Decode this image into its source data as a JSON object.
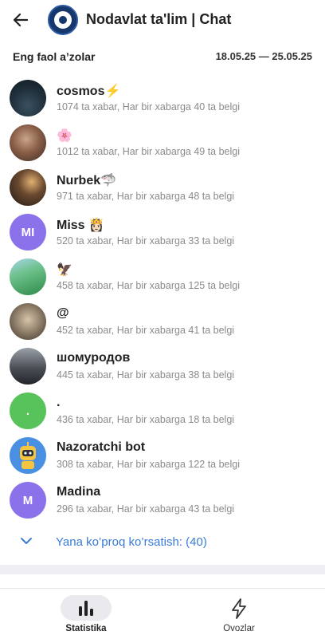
{
  "header": {
    "title": "Nodavlat ta'lim | Chat"
  },
  "section": {
    "title": "Eng faol a’zolar",
    "date_range": "18.05.25 — 25.05.25"
  },
  "members": [
    {
      "name": "cosmos⚡",
      "stats": "1074 ta xabar, Har bir xabarga 40 ta belgi",
      "avatar_initials": "",
      "avatar_color": "#1f2f3a"
    },
    {
      "name": "🌸",
      "stats": "1012 ta xabar, Har bir xabarga 49 ta belgi",
      "avatar_initials": "",
      "avatar_color": "#6b4a3a"
    },
    {
      "name": "Nurbek🦈",
      "stats": "971 ta xabar, Har bir xabarga 48 ta belgi",
      "avatar_initials": "",
      "avatar_color": "#3a2a22"
    },
    {
      "name": "Miss 👸🏻",
      "stats": "520 ta xabar, Har bir xabarga 33 ta belgi",
      "avatar_initials": "MI",
      "avatar_color": "#8c72ea"
    },
    {
      "name": "🦅",
      "stats": "458 ta xabar, Har bir xabarga 125 ta belgi",
      "avatar_initials": "",
      "avatar_color": "#4fae68"
    },
    {
      "name": "@",
      "stats": "452 ta xabar, Har bir xabarga 41 ta belgi",
      "avatar_initials": "",
      "avatar_color": "#8a7a66"
    },
    {
      "name": "шомуродов",
      "stats": "445 ta xabar, Har bir xabarga 38 ta belgi",
      "avatar_initials": "",
      "avatar_color": "#4c4f56"
    },
    {
      "name": ".",
      "stats": "436 ta xabar, Har bir xabarga 18 ta belgi",
      "avatar_initials": ".",
      "avatar_color": "#58c35a"
    },
    {
      "name": "Nazoratchi bot",
      "stats": "308 ta xabar, Har bir xabarga 122 ta belgi",
      "avatar_initials": "",
      "avatar_color": "#4a90e2"
    },
    {
      "name": "Madina",
      "stats": "296 ta xabar, Har bir xabarga 43 ta belgi",
      "avatar_initials": "M",
      "avatar_color": "#8c72ea"
    }
  ],
  "show_more": {
    "label": "Yana ko’proq ko’rsatish: (40)"
  },
  "bottom_nav": {
    "tab_statistics": "Statistika",
    "tab_votes": "Ovozlar"
  },
  "colors": {
    "accent": "#3a7bd5",
    "avatar_purple": "#8c72ea",
    "avatar_green": "#58c35a"
  }
}
